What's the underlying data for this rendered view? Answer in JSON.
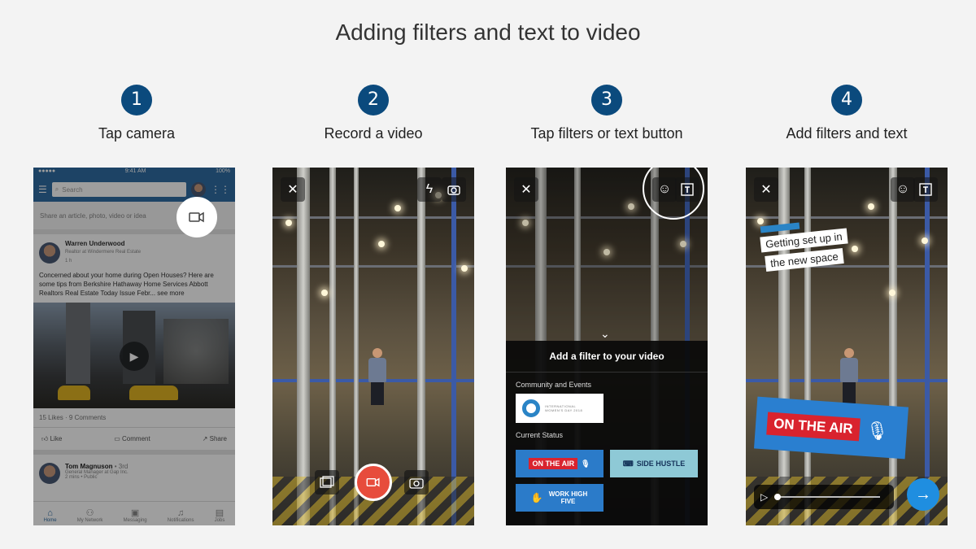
{
  "title": "Adding filters and text to video",
  "steps": [
    {
      "number": "1",
      "label": "Tap camera"
    },
    {
      "number": "2",
      "label": "Record a video"
    },
    {
      "number": "3",
      "label": "Tap filters or text button"
    },
    {
      "number": "4",
      "label": "Add filters and text"
    }
  ],
  "phone1": {
    "status_left": "●●●●● ",
    "status_time": "9:41 AM",
    "status_right": "100%",
    "search_placeholder": "Search",
    "share_prompt": "Share an article, photo, video or idea",
    "post": {
      "author": "Warren Underwood",
      "headline": "Realtor at Windermere Real Estate",
      "time": "1 h",
      "text": "Concerned about your home during Open Houses? Here are some tips from Berkshire Hathaway Home Services Abbott Realtors Real Estate Today Issue Febr... see more",
      "likes": "15 Likes",
      "comments": "9 Comments",
      "like_label": "Like",
      "comment_label": "Comment",
      "share_label": "Share"
    },
    "post2": {
      "author": "Tom Magnuson",
      "degree": "• 3rd",
      "headline": "General Manager at Gap Inc.",
      "time": "2 mins • Public"
    },
    "tabs": [
      "Home",
      "My Network",
      "Messaging",
      "Notifications",
      "Jobs"
    ]
  },
  "phone3": {
    "sheet_title": "Add a filter to your video",
    "section1": "Community and Events",
    "iwd_text": "INTERNATIONAL WOMEN'S DAY 2018",
    "section2": "Current Status",
    "filters": [
      "ON THE AIR",
      "SIDE HUSTLE",
      "WORK HIGH FIVE"
    ]
  },
  "phone4": {
    "caption_line1": "Getting set up in",
    "caption_line2": "the new space",
    "on_air": "ON THE AIR"
  },
  "colors": {
    "accent_blue": "#0b4a7d",
    "record_red": "#e74c3c",
    "linkedin_blue": "#2f6da3"
  }
}
